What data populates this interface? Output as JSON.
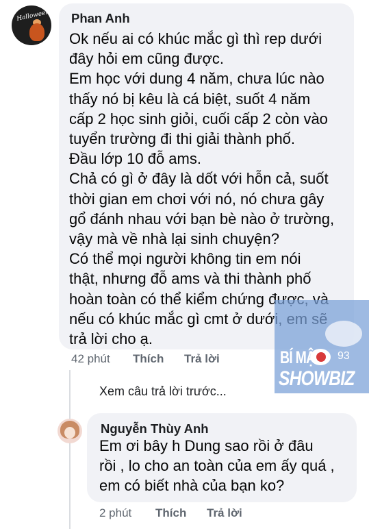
{
  "comment": {
    "author": "Phan Anh",
    "text": "Ok nếu ai có khúc mắc gì thì rep dưới\nđây hỏi em cũng được.\nEm học với dung 4 năm, chưa lúc nào\nthấy nó bị kêu là cá biệt, suốt 4 năm\ncấp 2 học sinh giỏi, cuối cấp 2 còn vào\ntuyển trường đi thi giải thành phố.\nĐầu lớp 10 đỗ ams.\nChả có gì ở đây là dốt với hỗn cả, suốt\nthời gian em chơi với nó, nó chưa gây\ngổ đánh nhau với bạn bè nào ở trường,\nvậy mà về nhà lại sinh chuyện?\nCó thể mọi người không tin em nói\nthật, nhưng đỗ ams và thi thành phố\nhoàn toàn có thể kiểm chứng được, và\nnếu có khúc mắc gì cmt ở dưới, em sẽ\ntrả lời cho ạ.",
    "time": "42 phút",
    "like_label": "Thích",
    "reply_label": "Trả lời"
  },
  "view_previous_replies": "Xem câu trả lời trước...",
  "reply": {
    "author": "Nguyễn Thùy Anh",
    "text": "Em ơi bây h Dung sao rồi ở đâu\nrồi , lo cho an toàn của em ấy quá ,\nem có biết nhà của bạn ko?",
    "time": "2 phút",
    "like_label": "Thích",
    "reply_label": "Trả lời"
  },
  "watermark": {
    "top_text": "BÍ MẬT",
    "number": "93",
    "bottom_text": "SHOWBIZ"
  },
  "avatar1": {
    "scribble": "Halloween"
  }
}
